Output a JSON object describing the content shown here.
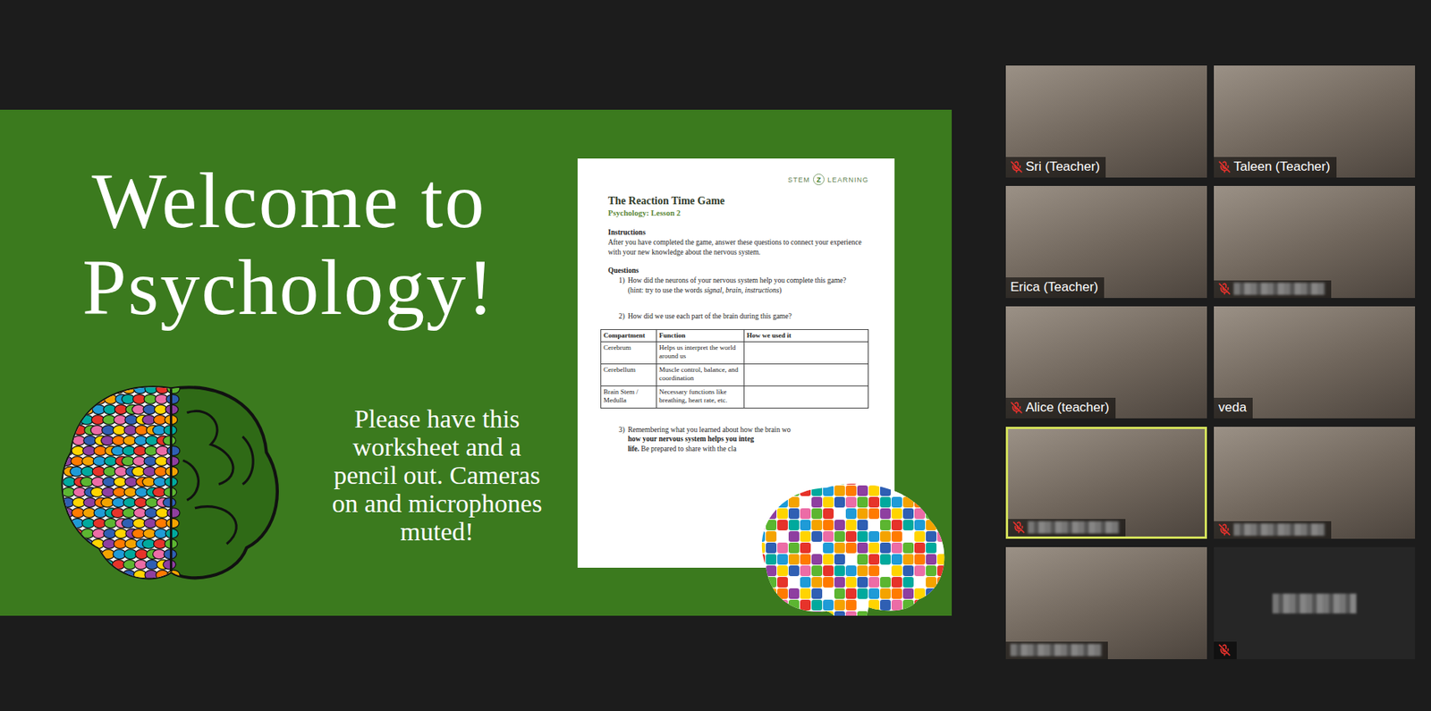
{
  "slide": {
    "title": [
      "Welcome to",
      "Psychology!"
    ],
    "note": "Please have this worksheet and a pencil out. Cameras on and microphones muted!",
    "worksheet": {
      "logo": {
        "left": "STEM",
        "mark": "Z",
        "right": "LEARNING"
      },
      "title": "The Reaction Time Game",
      "subtitle": "Psychology: Lesson 2",
      "instructions_heading": "Instructions",
      "instructions": "After you have completed the game, answer these questions to connect your experience with your new knowledge about the nervous system.",
      "questions_heading": "Questions",
      "questions": [
        {
          "number": "1)",
          "segments": [
            {
              "text": "How did the neurons of your nervous system help you complete this game?",
              "style": "normal"
            }
          ],
          "hint": [
            {
              "text": "(hint: try to use the words ",
              "style": "normal"
            },
            {
              "text": "signal, brain, instructions",
              "style": "italic"
            },
            {
              "text": ")",
              "style": "normal"
            }
          ]
        },
        {
          "number": "2)",
          "segments": [
            {
              "text": "How did we use each part of the brain during this game?",
              "style": "normal"
            }
          ],
          "hint": []
        }
      ],
      "table": {
        "columns": [
          "Compartment",
          "Function",
          "How we used it"
        ],
        "rows": [
          [
            "Cerebrum",
            "Helps us interpret the world around us"
          ],
          [
            "Cerebellum",
            "Muscle control, balance, and coordination"
          ],
          [
            "Brain Stem / Medulla",
            "Necessary functions like breathing, heart rate, etc."
          ]
        ]
      },
      "last_question": {
        "number": "3)",
        "lines": [
          [
            {
              "text": "Remembering what you learned about how the brain wo",
              "style": "normal"
            }
          ],
          [
            {
              "text": "how your nervous system helps you integ",
              "style": "bold"
            }
          ],
          [
            {
              "text": "life.",
              "style": "bold"
            },
            {
              "text": " Be prepared to share with the cla",
              "style": "normal"
            }
          ]
        ]
      }
    }
  },
  "participants": [
    {
      "name": "Sri (Teacher)",
      "name_hidden": false,
      "muted": true,
      "camera": true,
      "speaking": false
    },
    {
      "name": "Taleen (Teacher)",
      "name_hidden": false,
      "muted": true,
      "camera": true,
      "speaking": false
    },
    {
      "name": "Erica (Teacher)",
      "name_hidden": false,
      "muted": false,
      "camera": true,
      "speaking": false
    },
    {
      "name_hidden": true,
      "muted": true,
      "camera": true,
      "speaking": false
    },
    {
      "name": "Alice (teacher)",
      "name_hidden": false,
      "muted": true,
      "camera": true,
      "speaking": false
    },
    {
      "name": "veda",
      "name_hidden": false,
      "muted": false,
      "camera": true,
      "speaking": false
    },
    {
      "name_hidden": true,
      "muted": true,
      "camera": true,
      "speaking": true
    },
    {
      "name_hidden": true,
      "muted": true,
      "camera": true,
      "speaking": false
    },
    {
      "name_hidden": true,
      "muted": false,
      "camera": true,
      "speaking": false
    },
    {
      "name_hidden": true,
      "muted": true,
      "camera": false,
      "speaking": false
    }
  ]
}
